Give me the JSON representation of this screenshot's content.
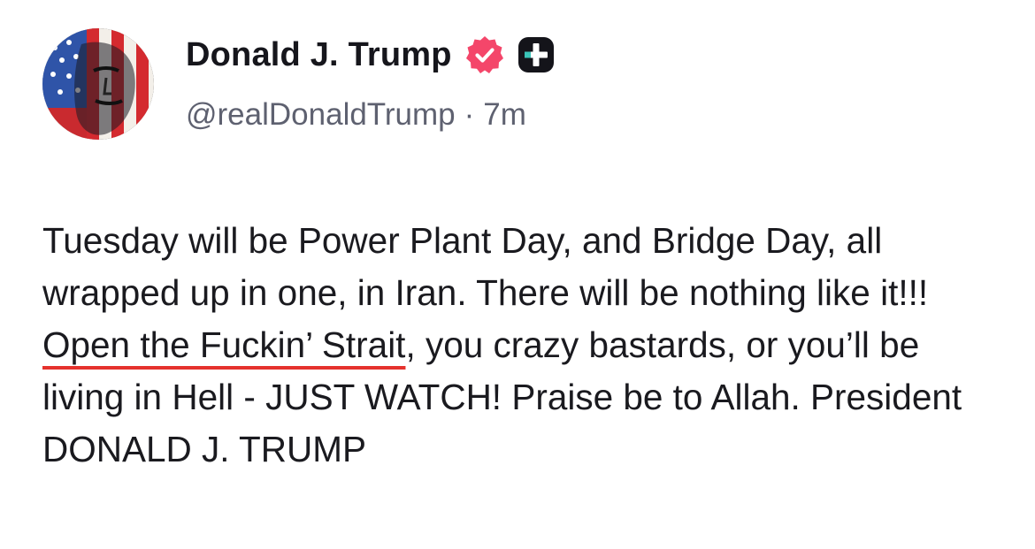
{
  "post": {
    "author": {
      "display_name": "Donald J. Trump",
      "handle": "@realDonaldTrump",
      "separator": "·",
      "time_ago": "7m",
      "avatar_icon": "flag-portrait-avatar",
      "verified_icon": "verified-badge-icon",
      "plus_icon": "plus-badge-icon",
      "verified_color": "#f4466a"
    },
    "body": {
      "part1": "Tuesday will be Power Plant Day, and Bridge Day, all wrapped up in one, in Iran. There will be nothing like it!!! ",
      "highlight": "Open the Fuckin’ Strait",
      "part2": ", you crazy bastards, or you’ll be living in Hell - JUST WATCH! Praise be to Allah. President DONALD J. TRUMP",
      "highlight_color": "#e5322d"
    }
  }
}
